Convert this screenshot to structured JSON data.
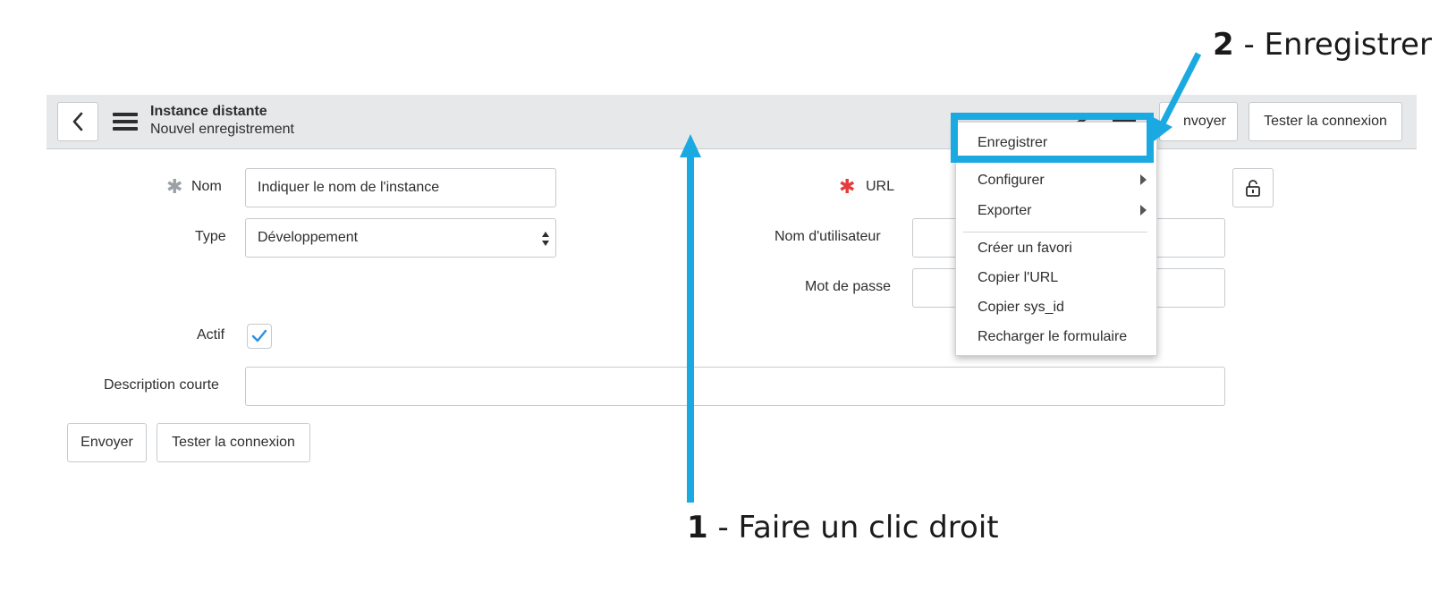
{
  "header": {
    "title": "Instance distante",
    "subtitle": "Nouvel enregistrement",
    "submit_label": "Envoyer",
    "test_label": "Tester la connexion",
    "submit_label_partial": "nvoyer"
  },
  "form": {
    "nom_label": "Nom",
    "nom_value": "Indiquer le nom de l'instance",
    "type_label": "Type",
    "type_value": "Développement",
    "url_label": "URL",
    "username_label": "Nom d'utilisateur",
    "password_label": "Mot de passe",
    "actif_label": "Actif",
    "actif_checked": true,
    "description_label": "Description courte",
    "description_value": "",
    "submit_label": "Envoyer",
    "test_label": "Tester la connexion"
  },
  "context_menu": {
    "items": [
      {
        "label": "Enregistrer"
      },
      {
        "label": "Configurer",
        "submenu": true
      },
      {
        "label": "Exporter",
        "submenu": true
      },
      {
        "label": "Créer un favori"
      },
      {
        "label": "Copier l'URL"
      },
      {
        "label": "Copier sys_id"
      },
      {
        "label": "Recharger le formulaire"
      }
    ]
  },
  "annotations": {
    "step1_number": "1",
    "step1_text": "- Faire un clic droit",
    "step2_number": "2",
    "step2_text": "- Enregistrer"
  },
  "colors": {
    "accent": "#1aa9e1",
    "required_red": "#e43c3c",
    "checkbox_blue": "#2f8fe0"
  }
}
